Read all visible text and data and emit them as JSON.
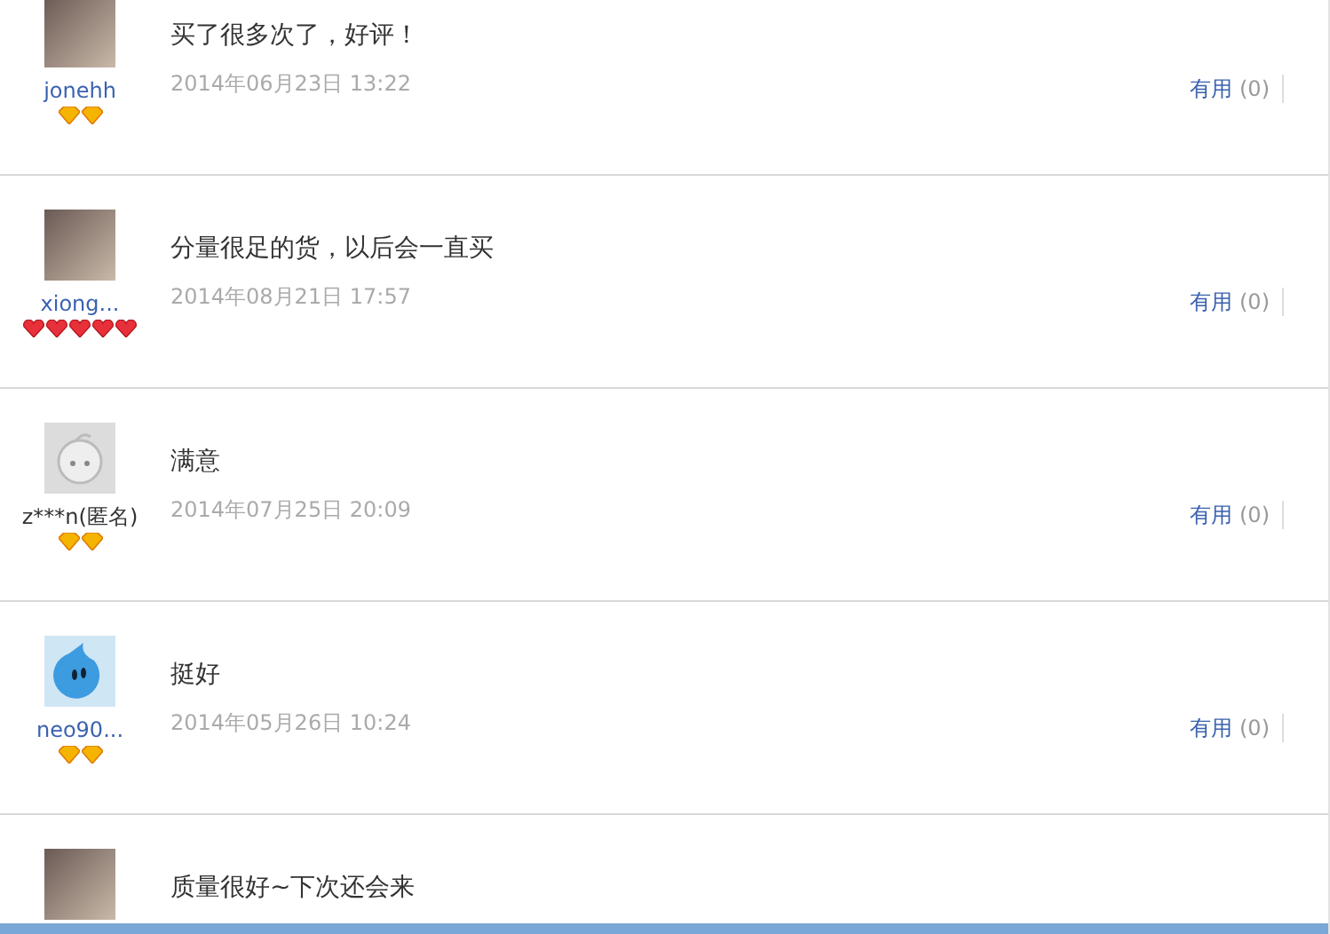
{
  "reviews": [
    {
      "user": {
        "name": "jonehh",
        "anonymous": false
      },
      "avatar": {
        "kind": "photo"
      },
      "badges": [
        {
          "kind": "diamond"
        },
        {
          "kind": "diamond"
        }
      ],
      "comment": "买了很多次了，好评！",
      "date": "2014年06月23日 13:22",
      "useful": {
        "label": "有用",
        "count": "(0)"
      }
    },
    {
      "user": {
        "name": "xiong...",
        "anonymous": false
      },
      "avatar": {
        "kind": "photo"
      },
      "badges": [
        {
          "kind": "heart"
        },
        {
          "kind": "heart"
        },
        {
          "kind": "heart"
        },
        {
          "kind": "heart"
        },
        {
          "kind": "heart"
        }
      ],
      "comment": "分量很足的货，以后会一直买",
      "date": "2014年08月21日 17:57",
      "useful": {
        "label": "有用",
        "count": "(0)"
      }
    },
    {
      "user": {
        "name": "z***n(匿名)",
        "anonymous": true
      },
      "avatar": {
        "kind": "default"
      },
      "badges": [
        {
          "kind": "diamond"
        },
        {
          "kind": "diamond"
        }
      ],
      "comment": "满意",
      "date": "2014年07月25日 20:09",
      "useful": {
        "label": "有用",
        "count": "(0)"
      }
    },
    {
      "user": {
        "name": "neo90...",
        "anonymous": false
      },
      "avatar": {
        "kind": "droplet"
      },
      "badges": [
        {
          "kind": "diamond"
        },
        {
          "kind": "diamond"
        }
      ],
      "comment": "挺好",
      "date": "2014年05月26日 10:24",
      "useful": {
        "label": "有用",
        "count": "(0)"
      }
    },
    {
      "avatar": {
        "kind": "photo"
      },
      "comment": "质量很好~下次还会来"
    }
  ]
}
